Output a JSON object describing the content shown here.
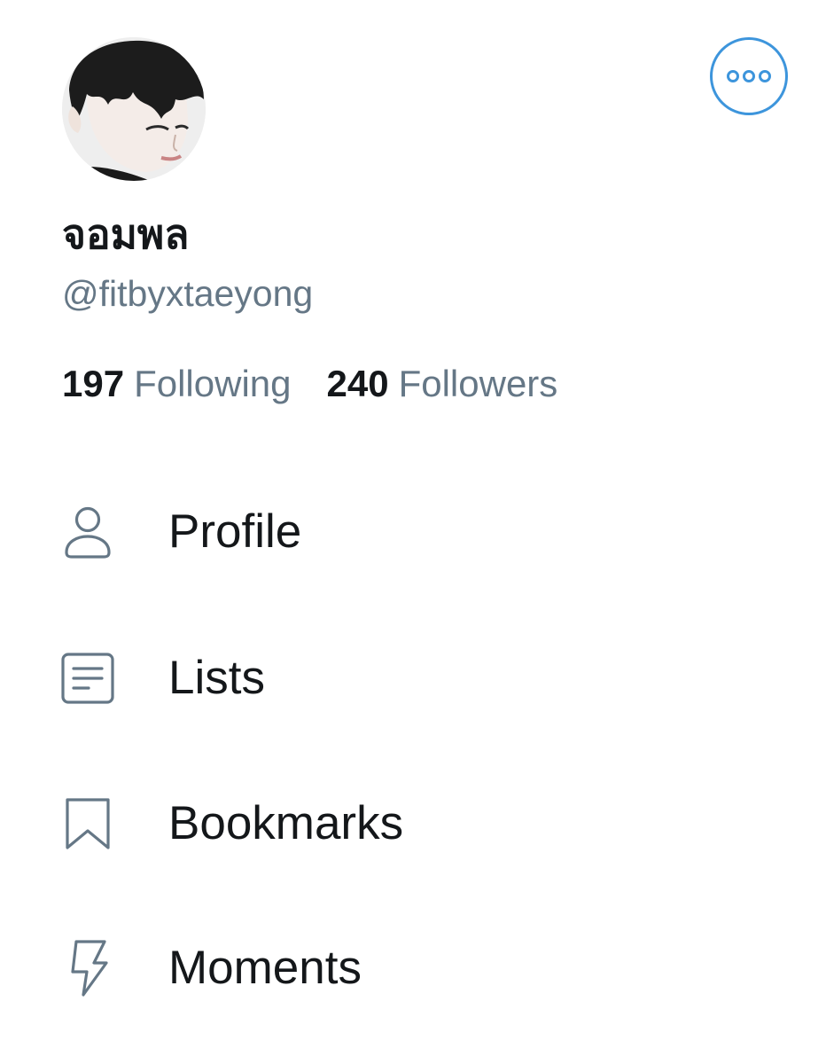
{
  "profile": {
    "display_name": "จอมพล",
    "handle": "@fitbyxtaeyong",
    "avatar_icon": "profile-photo",
    "more_icon": "ellipsis-icon"
  },
  "stats": {
    "following_count": "197",
    "following_label": "Following",
    "followers_count": "240",
    "followers_label": "Followers"
  },
  "menu": {
    "items": [
      {
        "label": "Profile",
        "icon": "person-icon"
      },
      {
        "label": "Lists",
        "icon": "list-icon"
      },
      {
        "label": "Bookmarks",
        "icon": "bookmark-icon"
      },
      {
        "label": "Moments",
        "icon": "lightning-icon"
      }
    ]
  },
  "colors": {
    "accent": "#3d95dc",
    "text_primary": "#14171a",
    "text_secondary": "#657786",
    "icon": "#657786"
  }
}
